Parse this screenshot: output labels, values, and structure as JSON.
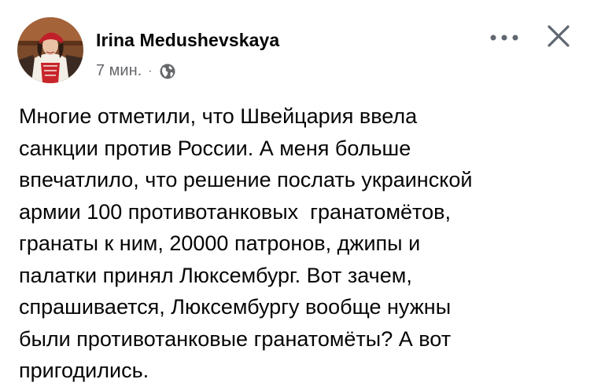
{
  "post": {
    "author": "Irina Medushevskaya",
    "time": "7 мин.",
    "separator": "·",
    "privacy_icon": "globe-icon",
    "more_icon": "more-dots-icon",
    "close_icon": "close-icon",
    "text_lines": [
      "Многие отметили, что Швейцария ввела",
      "санкции против России. А меня больше",
      "впечатлило, что решение послать украинской",
      "армии 100 противотанковых  гранатомётов,",
      "гранаты к ним, 20000 патронов, джипы и",
      "палатки принял Люксембург. Вот зачем,",
      "спрашивается, Люксембургу вообще нужны",
      "были противотанковые гранатомёты? А вот",
      "пригодились."
    ]
  },
  "colors": {
    "text_primary": "#050505",
    "text_secondary": "#65676b",
    "icon": "#606770",
    "background": "#ffffff"
  }
}
